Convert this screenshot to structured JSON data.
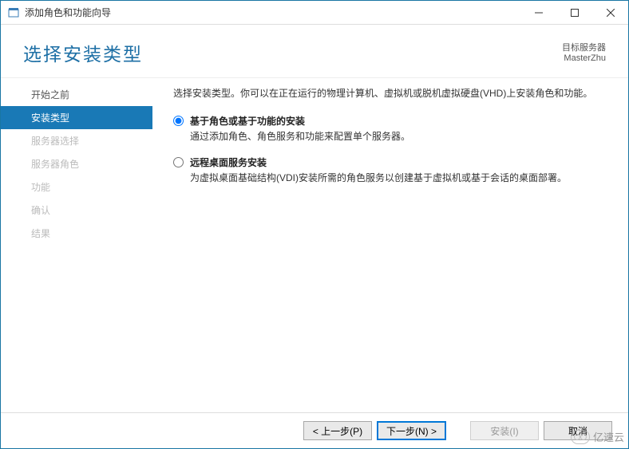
{
  "window": {
    "title": "添加角色和功能向导"
  },
  "header": {
    "title": "选择安装类型",
    "target_label": "目标服务器",
    "target_value": "MasterZhu"
  },
  "sidebar": {
    "items": [
      {
        "label": "开始之前",
        "state": "prev"
      },
      {
        "label": "安装类型",
        "state": "active"
      },
      {
        "label": "服务器选择",
        "state": "inactive"
      },
      {
        "label": "服务器角色",
        "state": "inactive"
      },
      {
        "label": "功能",
        "state": "inactive"
      },
      {
        "label": "确认",
        "state": "inactive"
      },
      {
        "label": "结果",
        "state": "inactive"
      }
    ]
  },
  "main": {
    "instruction": "选择安装类型。你可以在正在运行的物理计算机、虚拟机或脱机虚拟硬盘(VHD)上安装角色和功能。",
    "options": [
      {
        "title": "基于角色或基于功能的安装",
        "desc": "通过添加角色、角色服务和功能来配置单个服务器。",
        "checked": true
      },
      {
        "title": "远程桌面服务安装",
        "desc": "为虚拟桌面基础结构(VDI)安装所需的角色服务以创建基于虚拟机或基于会话的桌面部署。",
        "checked": false
      }
    ]
  },
  "footer": {
    "prev": "< 上一步(P)",
    "next": "下一步(N) >",
    "install": "安装(I)",
    "cancel": "取消"
  },
  "watermark": "亿速云"
}
